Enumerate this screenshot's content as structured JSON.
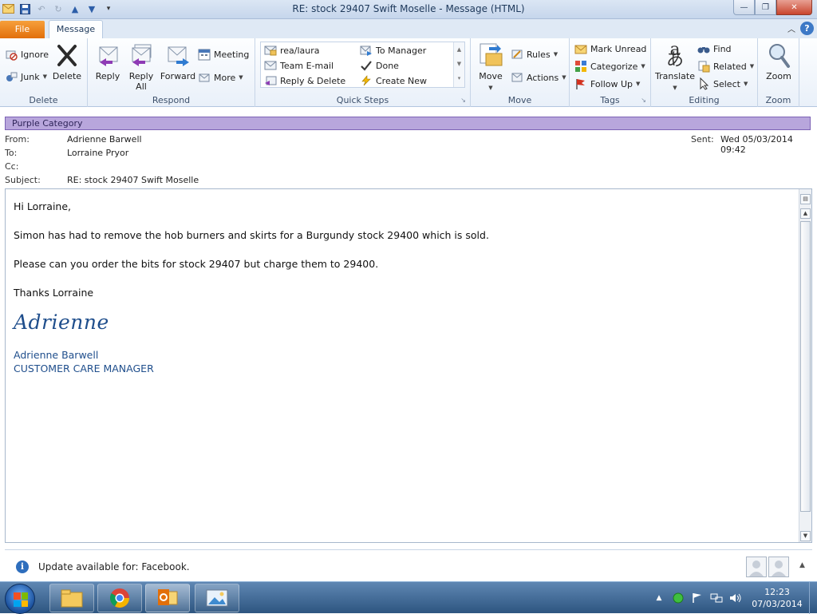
{
  "window": {
    "title": "RE: stock 29407 Swift Moselle  -  Message (HTML)"
  },
  "tabs": {
    "file": "File",
    "message": "Message"
  },
  "ribbon": {
    "delete_group": {
      "label": "Delete",
      "ignore": "Ignore",
      "junk": "Junk",
      "delete": "Delete"
    },
    "respond_group": {
      "label": "Respond",
      "reply": "Reply",
      "reply_all_1": "Reply",
      "reply_all_2": "All",
      "forward": "Forward",
      "meeting": "Meeting",
      "more": "More"
    },
    "quick_steps_group": {
      "label": "Quick Steps",
      "items": [
        "rea/laura",
        "To Manager",
        "Team E-mail",
        "Done",
        "Reply & Delete",
        "Create New"
      ]
    },
    "move_group": {
      "label": "Move",
      "move": "Move",
      "rules": "Rules",
      "actions": "Actions"
    },
    "tags_group": {
      "label": "Tags",
      "mark_unread": "Mark Unread",
      "categorize": "Categorize",
      "follow_up": "Follow Up"
    },
    "editing_group": {
      "label": "Editing",
      "translate": "Translate",
      "find": "Find",
      "related": "Related",
      "select": "Select"
    },
    "zoom_group": {
      "label": "Zoom",
      "zoom": "Zoom"
    }
  },
  "category": {
    "label": "Purple Category",
    "color": "#b8a6dc"
  },
  "headers": {
    "from_label": "From:",
    "from": "Adrienne Barwell",
    "to_label": "To:",
    "to": "Lorraine Pryor",
    "cc_label": "Cc:",
    "cc": "",
    "subject_label": "Subject:",
    "subject": "RE: stock 29407 Swift Moselle",
    "sent_label": "Sent:",
    "sent": "Wed 05/03/2014 09:42"
  },
  "message": {
    "greeting": "Hi Lorraine,",
    "para1": "Simon has had to remove the hob burners and skirts for  a Burgundy stock 29400 which is sold.",
    "para2": "Please can you order the bits for stock 29407 but charge them to 29400.",
    "closing": "Thanks Lorraine",
    "signature_script": "Adrienne",
    "signature_name": "Adrienne Barwell",
    "signature_title": "CUSTOMER CARE MANAGER"
  },
  "infobar": {
    "text": "Update available for: Facebook."
  },
  "taskbar": {
    "time": "12:23",
    "date": "07/03/2014"
  },
  "colors": {
    "accent": "#e26f0a",
    "link_blue": "#1f4e8c"
  }
}
